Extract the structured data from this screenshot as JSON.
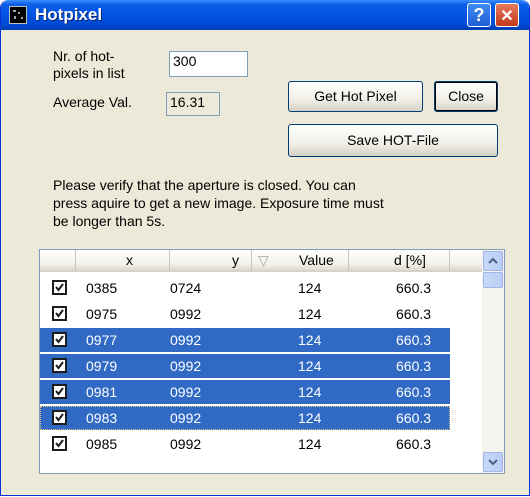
{
  "window": {
    "title": "Hotpixel",
    "help_glyph": "?",
    "close_glyph": "✕"
  },
  "form": {
    "hotpixels_label_line1": "Nr. of hot-",
    "hotpixels_label_line2": "pixels in list",
    "hotpixels_value": "300",
    "average_label": "Average Val.",
    "average_value": "16.31",
    "get_hot_pixel_label": "Get Hot Pixel",
    "close_label": "Close",
    "save_label": "Save HOT-File",
    "message_line1": "Please verify that the aperture is closed. You can",
    "message_line2": "press aquire to get a new image. Exposure time must",
    "message_line3": "be longer than 5s."
  },
  "table": {
    "columns": [
      "x",
      "y",
      "Value",
      "d [%]"
    ],
    "sort_indicator": "▽",
    "rows": [
      {
        "x": "0385",
        "y": "0724",
        "value": "124",
        "d": "660.3",
        "checked": true,
        "selected": false
      },
      {
        "x": "0975",
        "y": "0992",
        "value": "124",
        "d": "660.3",
        "checked": true,
        "selected": false
      },
      {
        "x": "0977",
        "y": "0992",
        "value": "124",
        "d": "660.3",
        "checked": true,
        "selected": true
      },
      {
        "x": "0979",
        "y": "0992",
        "value": "124",
        "d": "660.3",
        "checked": true,
        "selected": true
      },
      {
        "x": "0981",
        "y": "0992",
        "value": "124",
        "d": "660.3",
        "checked": true,
        "selected": true
      },
      {
        "x": "0983",
        "y": "0992",
        "value": "124",
        "d": "660.3",
        "checked": true,
        "selected": true
      },
      {
        "x": "0985",
        "y": "0992",
        "value": "124",
        "d": "660.3",
        "checked": true,
        "selected": false
      }
    ]
  },
  "colors": {
    "titlebar": "#0054e3",
    "selection": "#316ac5",
    "dialog_bg": "#ece9d8"
  },
  "icons": {
    "app": "app-icon",
    "help": "help-icon",
    "close": "close-icon",
    "scroll_up": "chevron-up-icon",
    "scroll_down": "chevron-down-icon",
    "checkbox": "check-icon"
  }
}
